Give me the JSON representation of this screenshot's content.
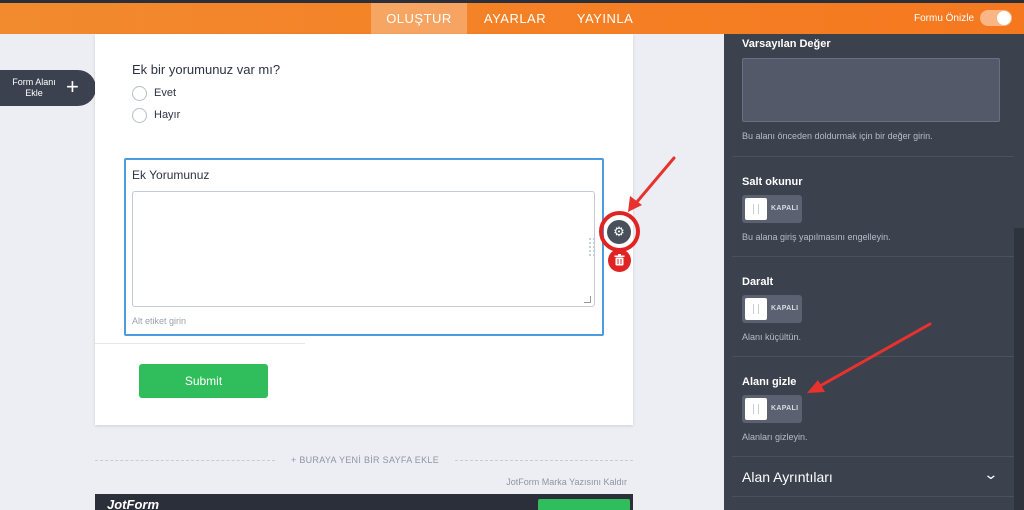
{
  "topbar": {
    "tabs": [
      {
        "label": "OLUŞTUR",
        "active": true
      },
      {
        "label": "AYARLAR",
        "active": false
      },
      {
        "label": "YAYINLA",
        "active": false
      }
    ],
    "preview_label": "Formu Önizle"
  },
  "add_field": {
    "label": "Form Alanı Ekle"
  },
  "form": {
    "question": "Ek bir yorumunuz var mı?",
    "options": [
      "Evet",
      "Hayır"
    ],
    "textarea_field": {
      "label": "Ek Yorumunuz",
      "sub_label_placeholder": "Alt etiket girin"
    },
    "submit_label": "Submit",
    "add_page_label": "+ BURAYA YENİ BİR SAYFA EKLE",
    "remove_brand_label": "JotForm Marka Yazısını Kaldır",
    "footer_brand": "JotForm"
  },
  "panel": {
    "default_value": {
      "title": "Varsayılan Değer",
      "desc": "Bu alanı önceden doldurmak için bir değer girin."
    },
    "readonly": {
      "title": "Salt okunur",
      "toggle": "KAPALI",
      "desc": "Bu alana giriş yapılmasını engelleyin."
    },
    "shrink": {
      "title": "Daralt",
      "toggle": "KAPALI",
      "desc": "Alanı küçültün."
    },
    "hide": {
      "title": "Alanı gizle",
      "toggle": "KAPALI",
      "desc": "Alanları gizleyin."
    },
    "details": {
      "title": "Alan Ayrıntıları"
    }
  },
  "colors": {
    "topbar": "#f5801f",
    "panel": "#3c414e",
    "submit": "#2fbe5b",
    "focus": "#4b9be0",
    "annotation": "#e02424"
  }
}
